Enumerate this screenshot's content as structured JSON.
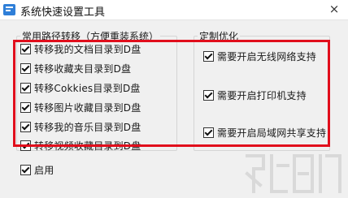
{
  "window": {
    "title": "系统快速设置工具",
    "close_symbol": "×"
  },
  "left_group": {
    "legend": "常用路径转移（方便重装系统）",
    "items": [
      {
        "label": "转移我的文档目录到D盘",
        "checked": true
      },
      {
        "label": "转移收藏夹目录到D盘",
        "checked": true
      },
      {
        "label": "转移Cokkies目录到D盘",
        "checked": true
      },
      {
        "label": "转移图片收藏目录到D盘",
        "checked": true
      },
      {
        "label": "转移我的音乐目录到D盘",
        "checked": true
      },
      {
        "label": "转移视频收藏目录到D盘",
        "checked": true
      }
    ]
  },
  "right_group": {
    "legend": "定制优化",
    "items": [
      {
        "label": "需要开启无线网络支持",
        "checked": true
      },
      {
        "label": "需要开启打印机支持",
        "checked": true
      },
      {
        "label": "需要开启局域网共享支持",
        "checked": true
      }
    ]
  },
  "enable": {
    "label": "启用",
    "checked": true
  },
  "colors": {
    "highlight": "#e10e1c",
    "app_icon": "#2f7fd8"
  },
  "icons": {
    "app": "settings-app-icon",
    "close": "close-icon",
    "check": "checkmark-icon",
    "watermark": "site-logo-watermark"
  }
}
